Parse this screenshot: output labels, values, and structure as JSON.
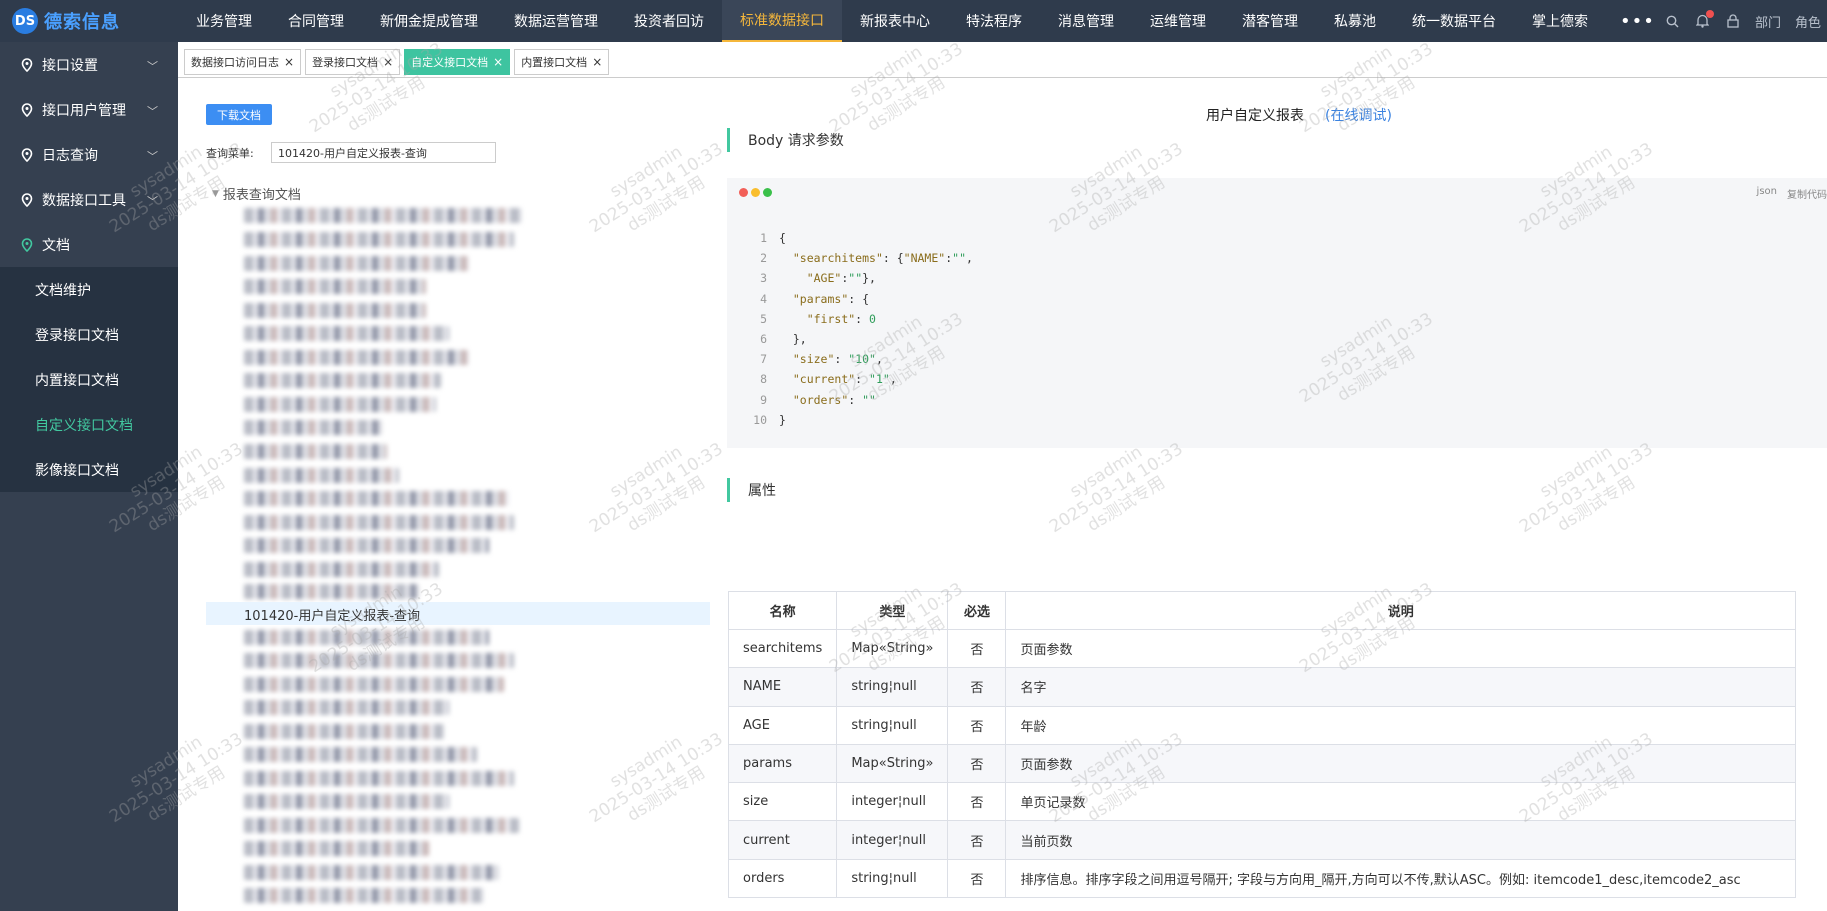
{
  "app": {
    "logo_text": "德索信息",
    "logo_mark": "DS"
  },
  "topnav": {
    "items": [
      "业务管理",
      "合同管理",
      "新佣金提成管理",
      "数据运营管理",
      "投资者回访",
      "标准数据接口",
      "新报表中心",
      "特法程序",
      "消息管理",
      "运维管理",
      "潜客管理",
      "私募池",
      "统一数据平台",
      "掌上德索"
    ],
    "active_index": 5,
    "more": "•••",
    "right_labels": [
      "部门",
      "角色"
    ]
  },
  "sidebar": {
    "groups": [
      "接口设置",
      "接口用户管理",
      "日志查询",
      "数据接口工具",
      "文档"
    ],
    "sub_items": [
      "文档维护",
      "登录接口文档",
      "内置接口文档",
      "自定义接口文档",
      "影像接口文档"
    ],
    "active_sub_index": 3
  },
  "tabs": [
    {
      "label": "数据接口访问日志",
      "active": false
    },
    {
      "label": "登录接口文档",
      "active": false
    },
    {
      "label": "自定义接口文档",
      "active": true
    },
    {
      "label": "内置接口文档",
      "active": false
    }
  ],
  "left": {
    "download_label": "下载文档",
    "menu_label": "查询菜单:",
    "menu_value": "101420-用户自定义报表-查询",
    "tree_root": "报表查询文档",
    "selected_item": "101420-用户自定义报表-查询"
  },
  "right": {
    "report_title": "用户自定义报表",
    "online_debug": "(在线调试)",
    "body_section": "Body 请求参数",
    "attr_section": "属性",
    "code_lang": "json",
    "copy_label": "复制代码",
    "code_lines": [
      "{",
      "  \"searchitems\": {\"NAME\":\"\",",
      "    \"AGE\":\"\"},",
      "  \"params\": {",
      "    \"first\": 0",
      "  },",
      "  \"size\": \"10\",",
      "  \"current\": \"1\",",
      "  \"orders\": \"\"",
      "}"
    ]
  },
  "table": {
    "headers": [
      "名称",
      "类型",
      "必选",
      "说明"
    ],
    "rows": [
      [
        "searchitems",
        "Map«String»",
        "否",
        "页面参数"
      ],
      [
        "NAME",
        "string¦null",
        "否",
        "名字"
      ],
      [
        "AGE",
        "string¦null",
        "否",
        "年龄"
      ],
      [
        "params",
        "Map«String»",
        "否",
        "页面参数"
      ],
      [
        "size",
        "integer¦null",
        "否",
        "单页记录数"
      ],
      [
        "current",
        "integer¦null",
        "否",
        "当前页数"
      ],
      [
        "orders",
        "string¦null",
        "否",
        "排序信息。排序字段之间用逗号隔开; 字段与方向用_隔开,方向可以不传,默认ASC。例如: itemcode1_desc,itemcode2_asc"
      ]
    ]
  },
  "watermark": [
    "sysadmin",
    "2025-03-14 10:33",
    "ds测试专用"
  ]
}
